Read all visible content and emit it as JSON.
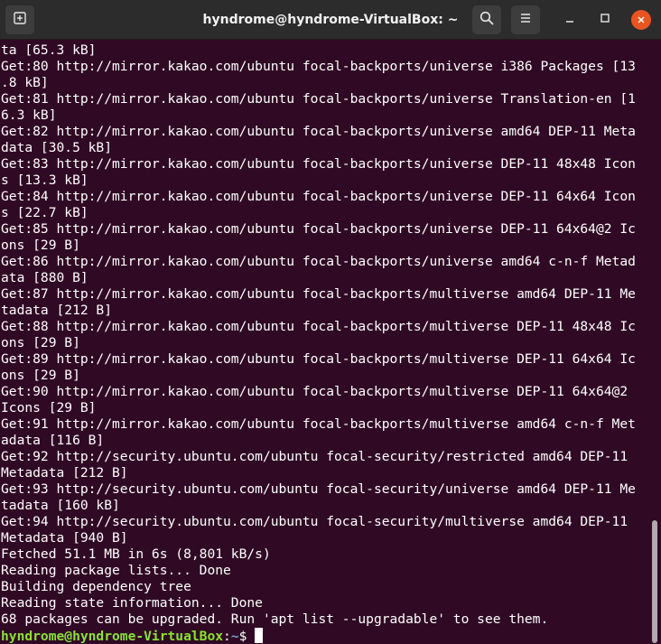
{
  "window": {
    "title": "hyndrome@hyndrome-VirtualBox: ~",
    "icons": {
      "new_tab": "new-tab-icon",
      "search": "search-icon",
      "menu": "hamburger-menu-icon",
      "minimize": "minimize-icon",
      "maximize": "maximize-icon",
      "close": "close-icon"
    }
  },
  "terminal": {
    "colors": {
      "background": "#300a24",
      "foreground": "#ffffff",
      "prompt_user": "#8ae234",
      "prompt_path": "#729fcf"
    },
    "lines": [
      "ta [65.3 kB]",
      "Get:80 http://mirror.kakao.com/ubuntu focal-backports/universe i386 Packages [13",
      ".8 kB]",
      "Get:81 http://mirror.kakao.com/ubuntu focal-backports/universe Translation-en [1",
      "6.3 kB]",
      "Get:82 http://mirror.kakao.com/ubuntu focal-backports/universe amd64 DEP-11 Meta",
      "data [30.5 kB]",
      "Get:83 http://mirror.kakao.com/ubuntu focal-backports/universe DEP-11 48x48 Icon",
      "s [13.3 kB]",
      "Get:84 http://mirror.kakao.com/ubuntu focal-backports/universe DEP-11 64x64 Icon",
      "s [22.7 kB]",
      "Get:85 http://mirror.kakao.com/ubuntu focal-backports/universe DEP-11 64x64@2 Ic",
      "ons [29 B]",
      "Get:86 http://mirror.kakao.com/ubuntu focal-backports/universe amd64 c-n-f Metad",
      "ata [880 B]",
      "Get:87 http://mirror.kakao.com/ubuntu focal-backports/multiverse amd64 DEP-11 Me",
      "tadata [212 B]",
      "Get:88 http://mirror.kakao.com/ubuntu focal-backports/multiverse DEP-11 48x48 Ic",
      "ons [29 B]",
      "Get:89 http://mirror.kakao.com/ubuntu focal-backports/multiverse DEP-11 64x64 Ic",
      "ons [29 B]",
      "Get:90 http://mirror.kakao.com/ubuntu focal-backports/multiverse DEP-11 64x64@2",
      "Icons [29 B]",
      "Get:91 http://mirror.kakao.com/ubuntu focal-backports/multiverse amd64 c-n-f Met",
      "adata [116 B]",
      "Get:92 http://security.ubuntu.com/ubuntu focal-security/restricted amd64 DEP-11",
      "Metadata [212 B]",
      "Get:93 http://security.ubuntu.com/ubuntu focal-security/universe amd64 DEP-11 Me",
      "tadata [160 kB]",
      "Get:94 http://security.ubuntu.com/ubuntu focal-security/multiverse amd64 DEP-11",
      "Metadata [940 B]",
      "Fetched 51.1 MB in 6s (8,801 kB/s)",
      "Reading package lists... Done",
      "Building dependency tree",
      "Reading state information... Done",
      "68 packages can be upgraded. Run 'apt list --upgradable' to see them."
    ],
    "prompt": {
      "user_host": "hyndrome@hyndrome-VirtualBox",
      "colon": ":",
      "path": "~",
      "symbol": "$ "
    }
  }
}
